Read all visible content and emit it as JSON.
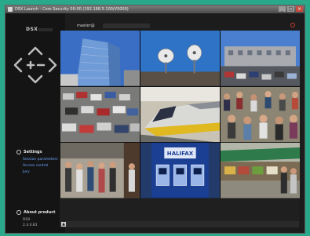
{
  "window": {
    "title": "DSX Launch - Core Security 00:00 (192.168.5.100/VS000)",
    "controls": [
      "_",
      "□",
      "×"
    ]
  },
  "sidebar": {
    "logo": "DSX",
    "settings": {
      "heading": "Settings",
      "items": [
        "Session parameters",
        "Access control",
        "Jury"
      ]
    },
    "about": {
      "heading": "About product",
      "lines": [
        "DSX",
        "2.3.0.81"
      ]
    }
  },
  "header": {
    "user": "master@"
  },
  "colors": {
    "accent_link": "#6fa8ff",
    "record": "#cc3b2f",
    "desktop": "#2aa98a"
  },
  "icons": {
    "dpad": "ptz-arrows-icon",
    "settings": "gear-icon",
    "about": "info-icon",
    "record": "record-icon"
  },
  "cameras": [
    {
      "id": "cam-1",
      "scene": "glass tower"
    },
    {
      "id": "cam-2",
      "scene": "satellite dishes"
    },
    {
      "id": "cam-3",
      "scene": "parking lot with building"
    },
    {
      "id": "cam-4",
      "scene": "parked cars"
    },
    {
      "id": "cam-5",
      "scene": "high-speed train"
    },
    {
      "id": "cam-6",
      "scene": "crowd"
    },
    {
      "id": "cam-7",
      "scene": "street crowd"
    },
    {
      "id": "cam-8",
      "scene": "Halifax cash machines",
      "sign": "HALIFAX"
    },
    {
      "id": "cam-9",
      "scene": "market stalls"
    }
  ]
}
